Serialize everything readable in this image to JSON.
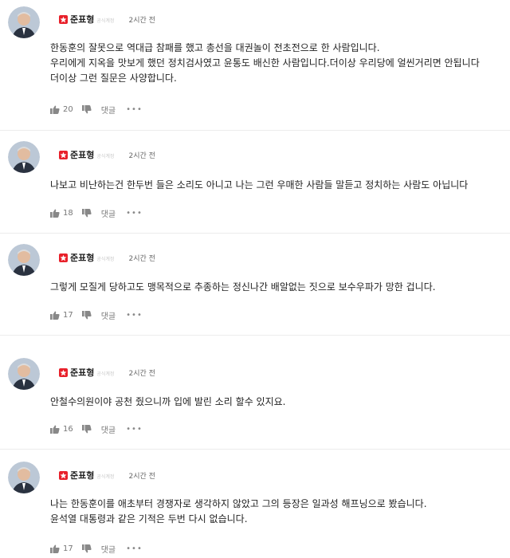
{
  "colors": {
    "badge": "#e8202a",
    "muted": "#777777",
    "text": "#222222",
    "divider": "#ececec"
  },
  "icons": {
    "badge": "party-badge-icon",
    "like": "thumbs-up-icon",
    "dislike": "thumbs-down-icon",
    "more": "more-dots-icon",
    "avatar": "avatar"
  },
  "comments": [
    {
      "author": "준표형",
      "official_tag": "공식계정",
      "time": "2시간 전",
      "lines": [
        "한동훈의 잘못으로 역대급 참패를 했고 총선을 대권놀이 전초전으로 한 사람입니다.",
        "우리에게 지옥을 맛보게 했던 정치검사였고 윤통도 배신한 사람입니다.더이상 우리당에 얼씬거리면 안됩니다",
        "더이상 그런 질문은 사양합니다."
      ],
      "likes": "20",
      "reply_label": "댓글",
      "more_label": "•••"
    },
    {
      "author": "준표형",
      "official_tag": "공식계정",
      "time": "2시간 전",
      "lines": [
        "나보고 비난하는건 한두번 들은 소리도 아니고 나는 그런 우매한 사람들 말듣고 정치하는 사람도 아닙니다"
      ],
      "likes": "18",
      "reply_label": "댓글",
      "more_label": "•••"
    },
    {
      "author": "준표형",
      "official_tag": "공식계정",
      "time": "2시간 전",
      "lines": [
        "그렇게 모질게 당하고도 맹목적으로 추종하는 정신나간 배알없는 짓으로 보수우파가 망한 겁니다."
      ],
      "likes": "17",
      "reply_label": "댓글",
      "more_label": "•••"
    },
    {
      "author": "준표형",
      "official_tag": "공식계정",
      "time": "2시간 전",
      "lines": [
        "안철수의원이야 공천 줬으니까 입에 발린 소리 할수 있지요."
      ],
      "likes": "16",
      "reply_label": "댓글",
      "more_label": "•••"
    },
    {
      "author": "준표형",
      "official_tag": "공식계정",
      "time": "2시간 전",
      "lines": [
        "나는 한동훈이를 애초부터 경쟁자로 생각하지 않았고 그의 등장은 일과성 해프닝으로 봤습니다.",
        "윤석열 대통령과 같은 기적은 두번 다시 없습니다."
      ],
      "likes": "17",
      "reply_label": "댓글",
      "more_label": "•••"
    }
  ]
}
